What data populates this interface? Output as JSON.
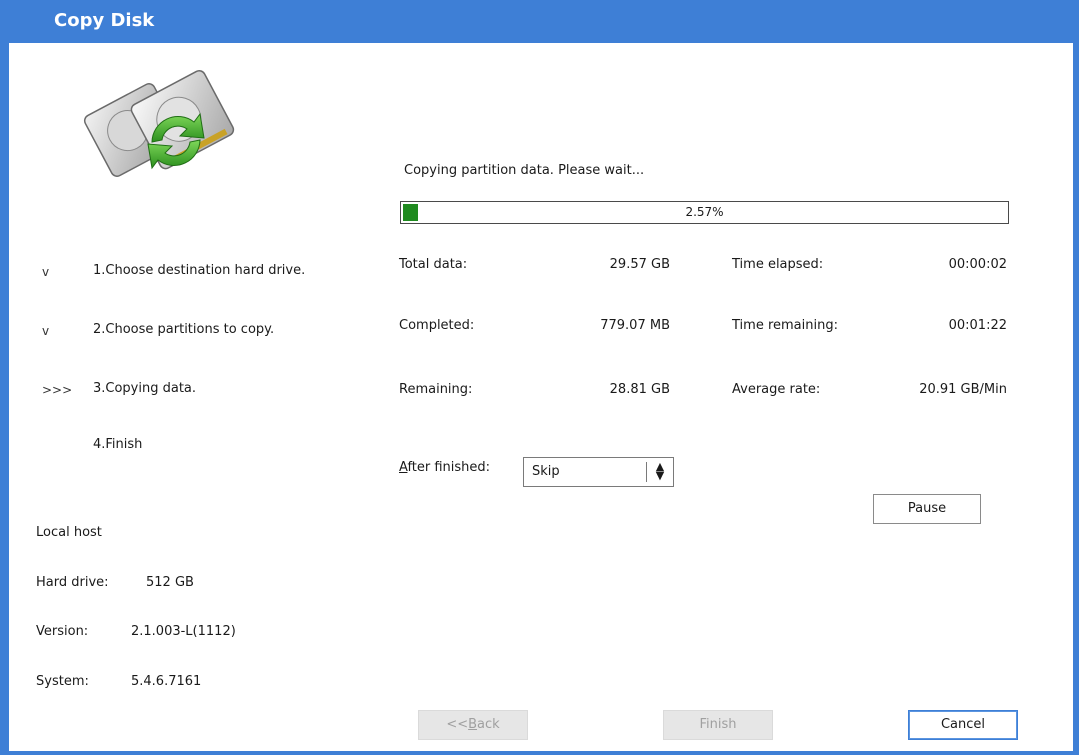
{
  "window": {
    "title": "Copy Disk"
  },
  "steps": [
    {
      "mark": "v",
      "label": "1.Choose destination hard drive."
    },
    {
      "mark": "v",
      "label": "2.Choose partitions to copy."
    },
    {
      "mark": ">>>",
      "label": "3.Copying data."
    },
    {
      "mark": "",
      "label": "4.Finish"
    }
  ],
  "host": {
    "title": "Local host",
    "hard_drive_label": "Hard drive:",
    "hard_drive_value": "512 GB",
    "version_label": "Version:",
    "version_value": "2.1.003-L(1112)",
    "system_label": "System:",
    "system_value": "5.4.6.7161"
  },
  "status": {
    "message": "Copying partition data. Please wait..."
  },
  "progress": {
    "percent_text": "2.57%",
    "fraction": 0.0257
  },
  "stats": {
    "total_label": "Total data:",
    "total_value": "29.57 GB",
    "completed_label": "Completed:",
    "completed_value": "779.07 MB",
    "remaining_label": "Remaining:",
    "remaining_value": "28.81 GB",
    "elapsed_label": "Time elapsed:",
    "elapsed_value": "00:00:02",
    "time_remaining_label": "Time remaining:",
    "time_remaining_value": "00:01:22",
    "rate_label": "Average rate:",
    "rate_value": "20.91 GB/Min"
  },
  "after_finished": {
    "label_prefix": "A",
    "label_rest": "fter finished:",
    "selected": "Skip"
  },
  "buttons": {
    "pause": "Pause",
    "back_prefix": "<<",
    "back_mnemonic": "B",
    "back_rest": "ack",
    "finish": "Finish",
    "cancel": "Cancel"
  },
  "colors": {
    "titlebar": "#3e7fd6",
    "progress_fill": "#1f8a1f"
  },
  "icons": {
    "disk_art": "hard-disk-copy-icon",
    "select_arrows": "up-down-arrows-icon"
  }
}
